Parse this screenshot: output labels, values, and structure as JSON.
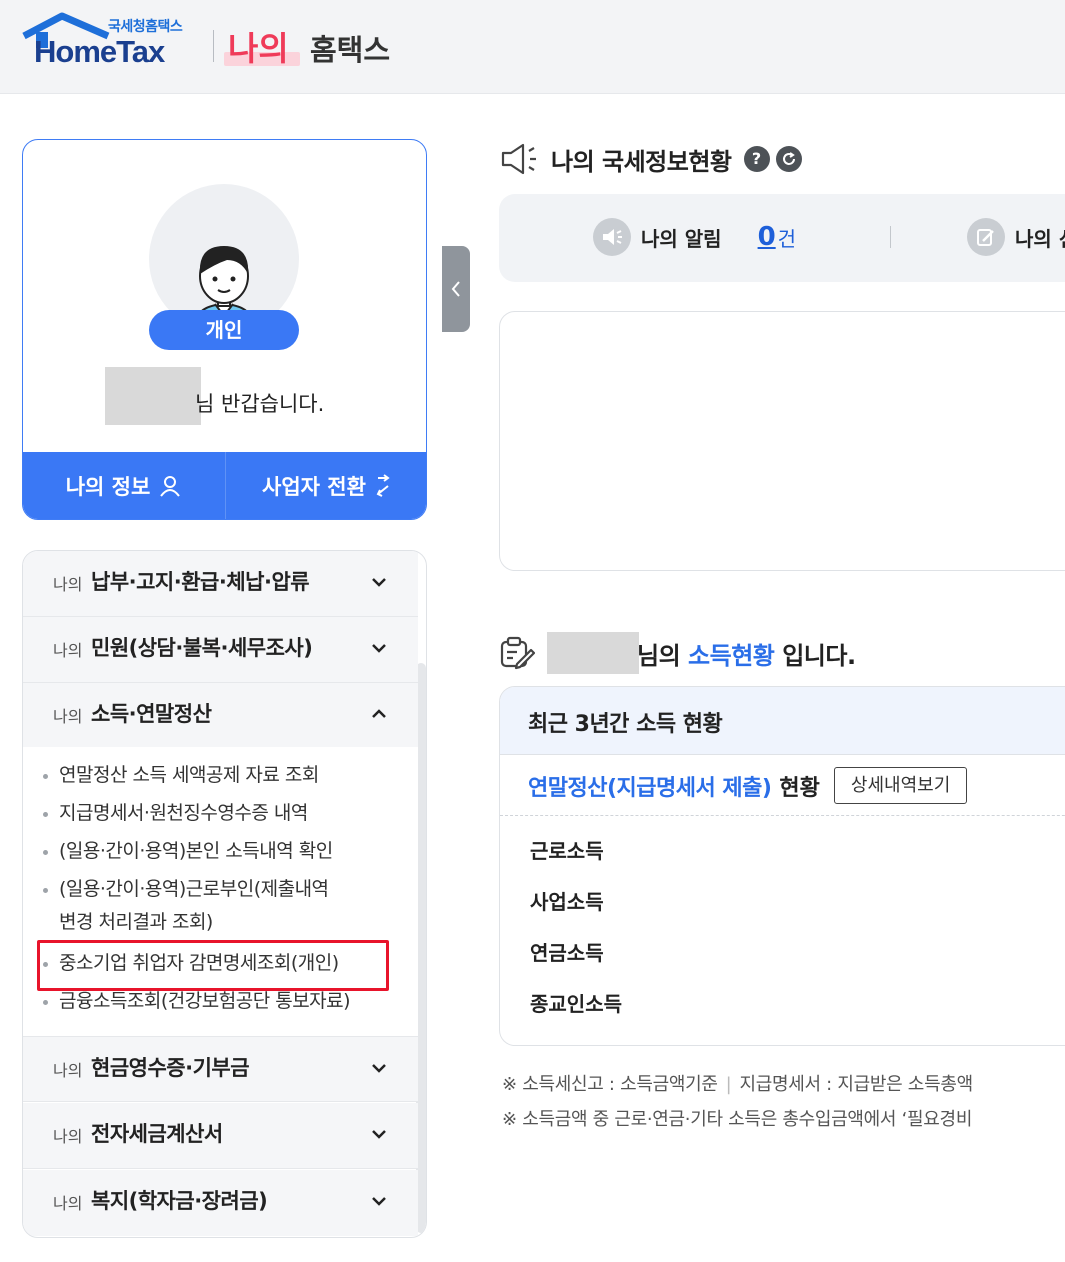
{
  "header": {
    "logo_sub": "국세청홈택스",
    "logo_brand": "HomeTax",
    "my_label": "나의",
    "home_label": "홈택스"
  },
  "profile": {
    "user_type": "개인",
    "greeting": "님 반갑습니다.",
    "my_info_button": "나의 정보",
    "switch_business_button": "사업자 전환"
  },
  "menu": {
    "prefix": "나의",
    "sections": [
      {
        "label": "납부·고지·환급·체납·압류",
        "expanded": false
      },
      {
        "label": "민원(상담·불복·세무조사)",
        "expanded": false
      },
      {
        "label": "소득·연말정산",
        "expanded": true
      },
      {
        "label": "현금영수증·기부금",
        "expanded": false
      },
      {
        "label": "전자세금계산서",
        "expanded": false
      },
      {
        "label": "복지(학자금·장려금)",
        "expanded": false
      }
    ],
    "sub_items": [
      "연말정산 소득 세액공제 자료 조회",
      "지급명세서·원천징수영수증 내역",
      "(일용·간이·용역)본인 소득내역 확인",
      "(일용·간이·용역)근로부인(제출내역",
      "변경 처리결과 조회)",
      "중소기업 취업자 감면명세조회(개인)",
      "금융소득조회(건강보험공단 통보자료)"
    ]
  },
  "tax_status": {
    "title": "나의 국세정보현황",
    "help": "?",
    "alerts": [
      {
        "label": "나의 알림",
        "count": "0",
        "unit": "건"
      },
      {
        "label": "나의 신"
      }
    ]
  },
  "income": {
    "title_suffix_1": "님의",
    "title_highlight": "소득현황",
    "title_suffix_2": "입니다.",
    "box_title": "최근 3년간 소득 현황",
    "yearend_highlight": "연말정산(지급명세서 제출)",
    "yearend_suffix": "현황",
    "detail_button": "상세내역보기",
    "rows": [
      "근로소득",
      "사업소득",
      "연금소득",
      "종교인소득"
    ]
  },
  "notes": {
    "line1_a": "※ 소득세신고 : 소득금액기준",
    "line1_sep": "|",
    "line1_b": "지급명세서 : 지급받은 소득총액",
    "line2": "※ 소득금액 중 근로·연금·기타 소득은 총수입금액에서 ‘필요경비"
  },
  "colors": {
    "accent_blue": "#3a78f5",
    "brand_pink": "#ef3b59",
    "highlight_red": "#e8142b"
  }
}
